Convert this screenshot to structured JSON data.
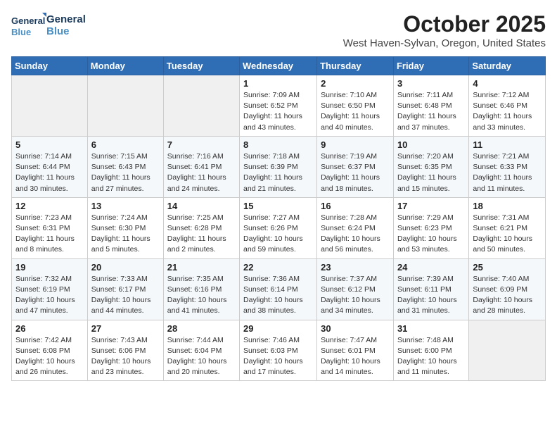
{
  "logo": {
    "line1": "General",
    "line2": "Blue"
  },
  "title": "October 2025",
  "location": "West Haven-Sylvan, Oregon, United States",
  "days_of_week": [
    "Sunday",
    "Monday",
    "Tuesday",
    "Wednesday",
    "Thursday",
    "Friday",
    "Saturday"
  ],
  "weeks": [
    [
      {
        "day": "",
        "info": ""
      },
      {
        "day": "",
        "info": ""
      },
      {
        "day": "",
        "info": ""
      },
      {
        "day": "1",
        "info": "Sunrise: 7:09 AM\nSunset: 6:52 PM\nDaylight: 11 hours and 43 minutes."
      },
      {
        "day": "2",
        "info": "Sunrise: 7:10 AM\nSunset: 6:50 PM\nDaylight: 11 hours and 40 minutes."
      },
      {
        "day": "3",
        "info": "Sunrise: 7:11 AM\nSunset: 6:48 PM\nDaylight: 11 hours and 37 minutes."
      },
      {
        "day": "4",
        "info": "Sunrise: 7:12 AM\nSunset: 6:46 PM\nDaylight: 11 hours and 33 minutes."
      }
    ],
    [
      {
        "day": "5",
        "info": "Sunrise: 7:14 AM\nSunset: 6:44 PM\nDaylight: 11 hours and 30 minutes."
      },
      {
        "day": "6",
        "info": "Sunrise: 7:15 AM\nSunset: 6:43 PM\nDaylight: 11 hours and 27 minutes."
      },
      {
        "day": "7",
        "info": "Sunrise: 7:16 AM\nSunset: 6:41 PM\nDaylight: 11 hours and 24 minutes."
      },
      {
        "day": "8",
        "info": "Sunrise: 7:18 AM\nSunset: 6:39 PM\nDaylight: 11 hours and 21 minutes."
      },
      {
        "day": "9",
        "info": "Sunrise: 7:19 AM\nSunset: 6:37 PM\nDaylight: 11 hours and 18 minutes."
      },
      {
        "day": "10",
        "info": "Sunrise: 7:20 AM\nSunset: 6:35 PM\nDaylight: 11 hours and 15 minutes."
      },
      {
        "day": "11",
        "info": "Sunrise: 7:21 AM\nSunset: 6:33 PM\nDaylight: 11 hours and 11 minutes."
      }
    ],
    [
      {
        "day": "12",
        "info": "Sunrise: 7:23 AM\nSunset: 6:31 PM\nDaylight: 11 hours and 8 minutes."
      },
      {
        "day": "13",
        "info": "Sunrise: 7:24 AM\nSunset: 6:30 PM\nDaylight: 11 hours and 5 minutes."
      },
      {
        "day": "14",
        "info": "Sunrise: 7:25 AM\nSunset: 6:28 PM\nDaylight: 11 hours and 2 minutes."
      },
      {
        "day": "15",
        "info": "Sunrise: 7:27 AM\nSunset: 6:26 PM\nDaylight: 10 hours and 59 minutes."
      },
      {
        "day": "16",
        "info": "Sunrise: 7:28 AM\nSunset: 6:24 PM\nDaylight: 10 hours and 56 minutes."
      },
      {
        "day": "17",
        "info": "Sunrise: 7:29 AM\nSunset: 6:23 PM\nDaylight: 10 hours and 53 minutes."
      },
      {
        "day": "18",
        "info": "Sunrise: 7:31 AM\nSunset: 6:21 PM\nDaylight: 10 hours and 50 minutes."
      }
    ],
    [
      {
        "day": "19",
        "info": "Sunrise: 7:32 AM\nSunset: 6:19 PM\nDaylight: 10 hours and 47 minutes."
      },
      {
        "day": "20",
        "info": "Sunrise: 7:33 AM\nSunset: 6:17 PM\nDaylight: 10 hours and 44 minutes."
      },
      {
        "day": "21",
        "info": "Sunrise: 7:35 AM\nSunset: 6:16 PM\nDaylight: 10 hours and 41 minutes."
      },
      {
        "day": "22",
        "info": "Sunrise: 7:36 AM\nSunset: 6:14 PM\nDaylight: 10 hours and 38 minutes."
      },
      {
        "day": "23",
        "info": "Sunrise: 7:37 AM\nSunset: 6:12 PM\nDaylight: 10 hours and 34 minutes."
      },
      {
        "day": "24",
        "info": "Sunrise: 7:39 AM\nSunset: 6:11 PM\nDaylight: 10 hours and 31 minutes."
      },
      {
        "day": "25",
        "info": "Sunrise: 7:40 AM\nSunset: 6:09 PM\nDaylight: 10 hours and 28 minutes."
      }
    ],
    [
      {
        "day": "26",
        "info": "Sunrise: 7:42 AM\nSunset: 6:08 PM\nDaylight: 10 hours and 26 minutes."
      },
      {
        "day": "27",
        "info": "Sunrise: 7:43 AM\nSunset: 6:06 PM\nDaylight: 10 hours and 23 minutes."
      },
      {
        "day": "28",
        "info": "Sunrise: 7:44 AM\nSunset: 6:04 PM\nDaylight: 10 hours and 20 minutes."
      },
      {
        "day": "29",
        "info": "Sunrise: 7:46 AM\nSunset: 6:03 PM\nDaylight: 10 hours and 17 minutes."
      },
      {
        "day": "30",
        "info": "Sunrise: 7:47 AM\nSunset: 6:01 PM\nDaylight: 10 hours and 14 minutes."
      },
      {
        "day": "31",
        "info": "Sunrise: 7:48 AM\nSunset: 6:00 PM\nDaylight: 10 hours and 11 minutes."
      },
      {
        "day": "",
        "info": ""
      }
    ]
  ]
}
